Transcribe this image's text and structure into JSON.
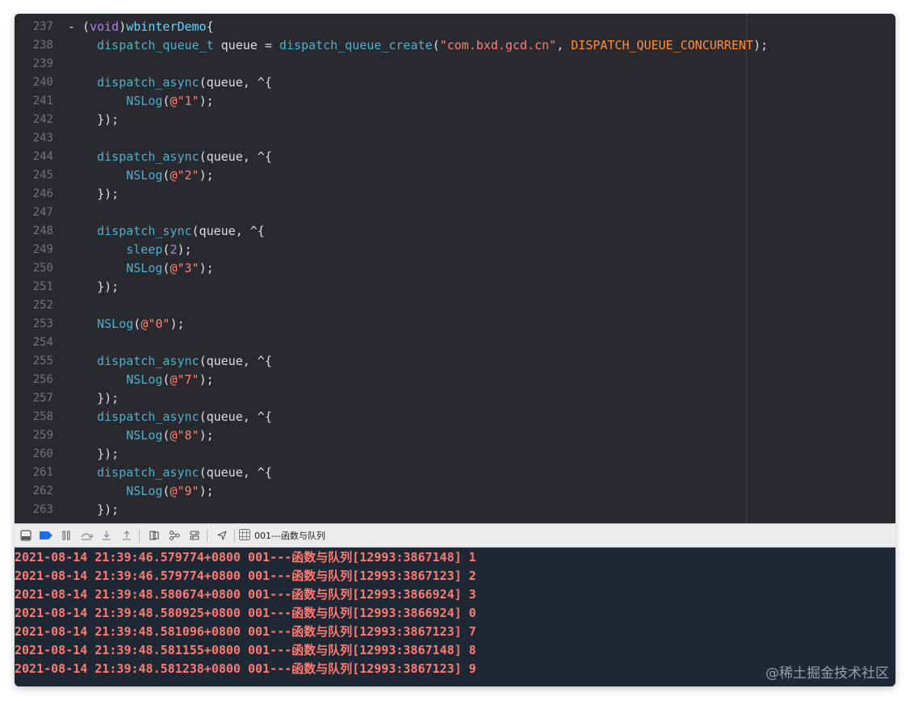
{
  "editor": {
    "lines": [
      {
        "num": "237",
        "tokens": [
          {
            "t": "- (",
            "c": "plain"
          },
          {
            "t": "void",
            "c": "kw"
          },
          {
            "t": ")",
            "c": "plain"
          },
          {
            "t": "wbinterDemo",
            "c": "wb"
          },
          {
            "t": "{",
            "c": "plain"
          }
        ]
      },
      {
        "num": "238",
        "tokens": [
          {
            "t": "    ",
            "c": "plain"
          },
          {
            "t": "dispatch_queue_t",
            "c": "call"
          },
          {
            "t": " queue = ",
            "c": "plain"
          },
          {
            "t": "dispatch_queue_create",
            "c": "call"
          },
          {
            "t": "(",
            "c": "plain"
          },
          {
            "t": "\"com.bxd.gcd.cn\"",
            "c": "str"
          },
          {
            "t": ", ",
            "c": "plain"
          },
          {
            "t": "DISPATCH_QUEUE_CONCURRENT",
            "c": "mac"
          },
          {
            "t": ");",
            "c": "plain"
          }
        ]
      },
      {
        "num": "239",
        "tokens": []
      },
      {
        "num": "240",
        "tokens": [
          {
            "t": "    ",
            "c": "plain"
          },
          {
            "t": "dispatch_async",
            "c": "call"
          },
          {
            "t": "(queue, ^{",
            "c": "plain"
          }
        ]
      },
      {
        "num": "241",
        "tokens": [
          {
            "t": "        ",
            "c": "plain"
          },
          {
            "t": "NSLog",
            "c": "call"
          },
          {
            "t": "(",
            "c": "plain"
          },
          {
            "t": "@\"1\"",
            "c": "str"
          },
          {
            "t": ");",
            "c": "plain"
          }
        ]
      },
      {
        "num": "242",
        "tokens": [
          {
            "t": "    });",
            "c": "plain"
          }
        ]
      },
      {
        "num": "243",
        "tokens": []
      },
      {
        "num": "244",
        "tokens": [
          {
            "t": "    ",
            "c": "plain"
          },
          {
            "t": "dispatch_async",
            "c": "call"
          },
          {
            "t": "(queue, ^{",
            "c": "plain"
          }
        ]
      },
      {
        "num": "245",
        "tokens": [
          {
            "t": "        ",
            "c": "plain"
          },
          {
            "t": "NSLog",
            "c": "call"
          },
          {
            "t": "(",
            "c": "plain"
          },
          {
            "t": "@\"2\"",
            "c": "str"
          },
          {
            "t": ");",
            "c": "plain"
          }
        ]
      },
      {
        "num": "246",
        "tokens": [
          {
            "t": "    });",
            "c": "plain"
          }
        ]
      },
      {
        "num": "247",
        "tokens": []
      },
      {
        "num": "248",
        "tokens": [
          {
            "t": "    ",
            "c": "plain"
          },
          {
            "t": "dispatch_sync",
            "c": "call"
          },
          {
            "t": "(queue, ^{",
            "c": "plain"
          }
        ]
      },
      {
        "num": "249",
        "tokens": [
          {
            "t": "        ",
            "c": "plain"
          },
          {
            "t": "sleep",
            "c": "call"
          },
          {
            "t": "(",
            "c": "plain"
          },
          {
            "t": "2",
            "c": "kw"
          },
          {
            "t": ");",
            "c": "plain"
          }
        ]
      },
      {
        "num": "250",
        "tokens": [
          {
            "t": "        ",
            "c": "plain"
          },
          {
            "t": "NSLog",
            "c": "call"
          },
          {
            "t": "(",
            "c": "plain"
          },
          {
            "t": "@\"3\"",
            "c": "str"
          },
          {
            "t": ");",
            "c": "plain"
          }
        ]
      },
      {
        "num": "251",
        "tokens": [
          {
            "t": "    });",
            "c": "plain"
          }
        ]
      },
      {
        "num": "252",
        "tokens": []
      },
      {
        "num": "253",
        "tokens": [
          {
            "t": "    ",
            "c": "plain"
          },
          {
            "t": "NSLog",
            "c": "call"
          },
          {
            "t": "(",
            "c": "plain"
          },
          {
            "t": "@\"0\"",
            "c": "str"
          },
          {
            "t": ");",
            "c": "plain"
          }
        ]
      },
      {
        "num": "254",
        "tokens": []
      },
      {
        "num": "255",
        "tokens": [
          {
            "t": "    ",
            "c": "plain"
          },
          {
            "t": "dispatch_async",
            "c": "call"
          },
          {
            "t": "(queue, ^{",
            "c": "plain"
          }
        ]
      },
      {
        "num": "256",
        "tokens": [
          {
            "t": "        ",
            "c": "plain"
          },
          {
            "t": "NSLog",
            "c": "call"
          },
          {
            "t": "(",
            "c": "plain"
          },
          {
            "t": "@\"7\"",
            "c": "str"
          },
          {
            "t": ");",
            "c": "plain"
          }
        ]
      },
      {
        "num": "257",
        "tokens": [
          {
            "t": "    });",
            "c": "plain"
          }
        ]
      },
      {
        "num": "258",
        "tokens": [
          {
            "t": "    ",
            "c": "plain"
          },
          {
            "t": "dispatch_async",
            "c": "call"
          },
          {
            "t": "(queue, ^{",
            "c": "plain"
          }
        ]
      },
      {
        "num": "259",
        "tokens": [
          {
            "t": "        ",
            "c": "plain"
          },
          {
            "t": "NSLog",
            "c": "call"
          },
          {
            "t": "(",
            "c": "plain"
          },
          {
            "t": "@\"8\"",
            "c": "str"
          },
          {
            "t": ");",
            "c": "plain"
          }
        ]
      },
      {
        "num": "260",
        "tokens": [
          {
            "t": "    });",
            "c": "plain"
          }
        ]
      },
      {
        "num": "261",
        "tokens": [
          {
            "t": "    ",
            "c": "plain"
          },
          {
            "t": "dispatch_async",
            "c": "call"
          },
          {
            "t": "(queue, ^{",
            "c": "plain"
          }
        ]
      },
      {
        "num": "262",
        "tokens": [
          {
            "t": "        ",
            "c": "plain"
          },
          {
            "t": "NSLog",
            "c": "call"
          },
          {
            "t": "(",
            "c": "plain"
          },
          {
            "t": "@\"9\"",
            "c": "str"
          },
          {
            "t": ");",
            "c": "plain"
          }
        ]
      },
      {
        "num": "263",
        "tokens": [
          {
            "t": "    });",
            "c": "plain"
          }
        ]
      }
    ]
  },
  "debug_bar": {
    "buttons": [
      {
        "name": "hide-debug-area-button",
        "icon": "panel-bottom-icon"
      },
      {
        "name": "breakpoints-toggle-button",
        "icon": "breakpoint-icon"
      },
      {
        "name": "pause-button",
        "icon": "pause-icon"
      },
      {
        "name": "step-over-button",
        "icon": "step-over-icon"
      },
      {
        "name": "step-into-button",
        "icon": "step-into-icon"
      },
      {
        "name": "step-out-button",
        "icon": "step-out-icon"
      },
      {
        "name": "view-hierarchy-button",
        "icon": "view-hierarchy-icon"
      },
      {
        "name": "memory-graph-button",
        "icon": "memory-graph-icon"
      },
      {
        "name": "environment-overrides-button",
        "icon": "environment-icon"
      },
      {
        "name": "simulate-location-button",
        "icon": "location-arrow-icon"
      }
    ],
    "target_label": "001---函数与队列"
  },
  "console": {
    "lines": [
      "2021-08-14 21:39:46.579774+0800 001---函数与队列[12993:3867148] 1",
      "2021-08-14 21:39:46.579774+0800 001---函数与队列[12993:3867123] 2",
      "2021-08-14 21:39:48.580674+0800 001---函数与队列[12993:3866924] 3",
      "2021-08-14 21:39:48.580925+0800 001---函数与队列[12993:3866924] 0",
      "2021-08-14 21:39:48.581096+0800 001---函数与队列[12993:3867123] 7",
      "2021-08-14 21:39:48.581155+0800 001---函数与队列[12993:3867148] 8",
      "2021-08-14 21:39:48.581238+0800 001---函数与队列[12993:3867123] 9"
    ]
  },
  "watermark": "@稀土掘金技术社区",
  "colors": {
    "editor_bg": "#292a30",
    "console_bg": "#1f2935",
    "console_text": "#ff7b72",
    "string": "#ff8170",
    "keyword": "#b281eb",
    "call": "#4eb0cc",
    "macro": "#fd8f3f"
  }
}
